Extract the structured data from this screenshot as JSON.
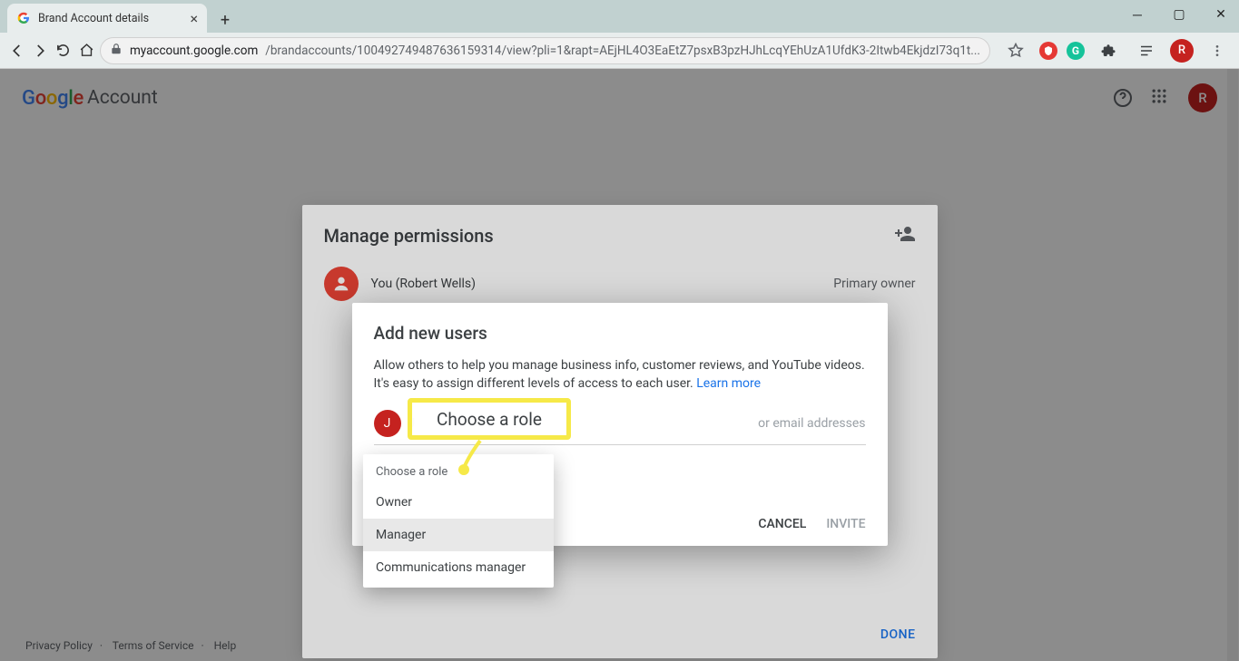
{
  "browser": {
    "tab_title": "Brand Account details",
    "url_host": "myaccount.google.com",
    "url_path": "/brandaccounts/100492749487636159314/view?pli=1&rapt=AEjHL4O3EaEtZ7psxB3pzHJhLcqYEhUzA1UfdK3-2Itwb4EkjdzI73q1t...",
    "avatar_letter": "R"
  },
  "header": {
    "product": "Account",
    "avatar_letter": "R"
  },
  "perm_panel": {
    "title": "Manage permissions",
    "user_name": "You (Robert Wells)",
    "user_role": "Primary owner",
    "done": "DONE"
  },
  "dialog": {
    "title": "Add new users",
    "body": "Allow others to help you manage business info, customer reviews, and YouTube videos. It's easy to assign different levels of access to each user. ",
    "learn_more": "Learn more",
    "chip_letter": "J",
    "chip_name": "J",
    "entry_placeholder": "or email addresses",
    "choose_role_label": "Choose a role",
    "cancel": "CANCEL",
    "invite": "INVITE"
  },
  "menu": {
    "header": "Choose a role",
    "items": [
      "Owner",
      "Manager",
      "Communications manager"
    ],
    "hover_index": 1
  },
  "annotation": {
    "label": "Choose a role"
  },
  "footer": {
    "privacy": "Privacy Policy",
    "terms": "Terms of Service",
    "help": "Help"
  }
}
